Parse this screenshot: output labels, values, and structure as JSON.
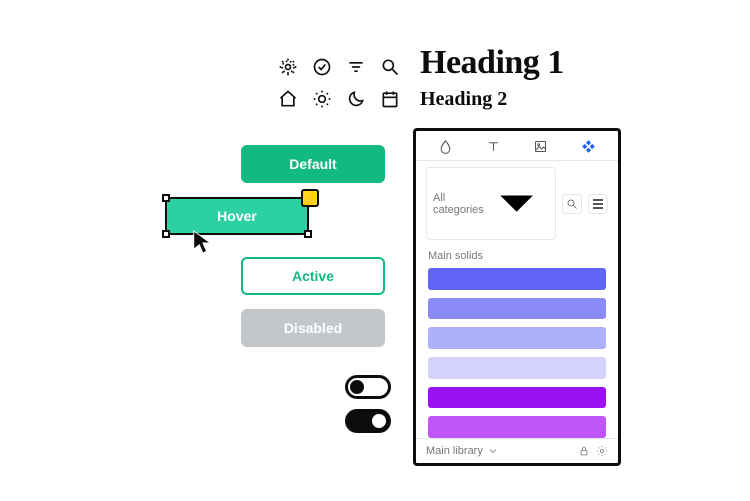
{
  "headings": {
    "h1": "Heading 1",
    "h2": "Heading 2"
  },
  "icons": [
    "settings",
    "checkmark-circle",
    "filter",
    "search",
    "home",
    "sun",
    "moon",
    "calendar"
  ],
  "buttons": {
    "default": "Default",
    "hover": "Hover",
    "active": "Active",
    "disabled": "Disabled"
  },
  "toggles": {
    "off": false,
    "on": true
  },
  "panel": {
    "tabs": [
      "drop",
      "text",
      "image",
      "component"
    ],
    "active_tab": 3,
    "category_label": "All categories",
    "section_label": "Main solids",
    "swatches": [
      "#6165f6",
      "#8a8af8",
      "#adb1fa",
      "#d3d3fb",
      "#9a12f2",
      "#c156f8"
    ],
    "library_label": "Main library"
  }
}
